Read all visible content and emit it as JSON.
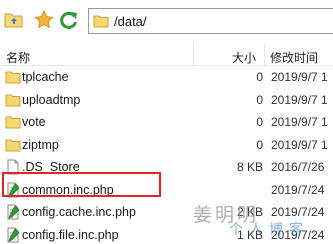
{
  "path": {
    "value": "/data/"
  },
  "columns": {
    "name": "名称",
    "size": "大小",
    "modified": "修改时间"
  },
  "files": [
    {
      "name": "tplcache",
      "size": "0",
      "date": "2019/9/7 1",
      "icon": "folder-icon"
    },
    {
      "name": "uploadtmp",
      "size": "0",
      "date": "2019/9/7 1",
      "icon": "folder-icon"
    },
    {
      "name": "vote",
      "size": "0",
      "date": "2019/9/7 1",
      "icon": "folder-icon"
    },
    {
      "name": "ziptmp",
      "size": "0",
      "date": "2019/9/7 1",
      "icon": "folder-icon"
    },
    {
      "name": ".DS_Store",
      "size": "8 KB",
      "date": "2016/7/26",
      "icon": "file-icon"
    },
    {
      "name": "common.inc.php",
      "size": "",
      "date": "2019/7/24",
      "icon": "php-file-icon"
    },
    {
      "name": "config.cache.inc.php",
      "size": "2 KB",
      "date": "2019/7/24",
      "icon": "php-file-icon"
    },
    {
      "name": "config.file.inc.php",
      "size": "1 KB",
      "date": "2019/7/24",
      "icon": "php-file-icon"
    }
  ],
  "watermark": {
    "line1": "姜明明",
    "line2": "个人博客"
  },
  "colors": {
    "highlight": "#e0242b",
    "folder": "#f7d774",
    "refresh": "#2f9a3a",
    "star": "#f2b53a"
  }
}
